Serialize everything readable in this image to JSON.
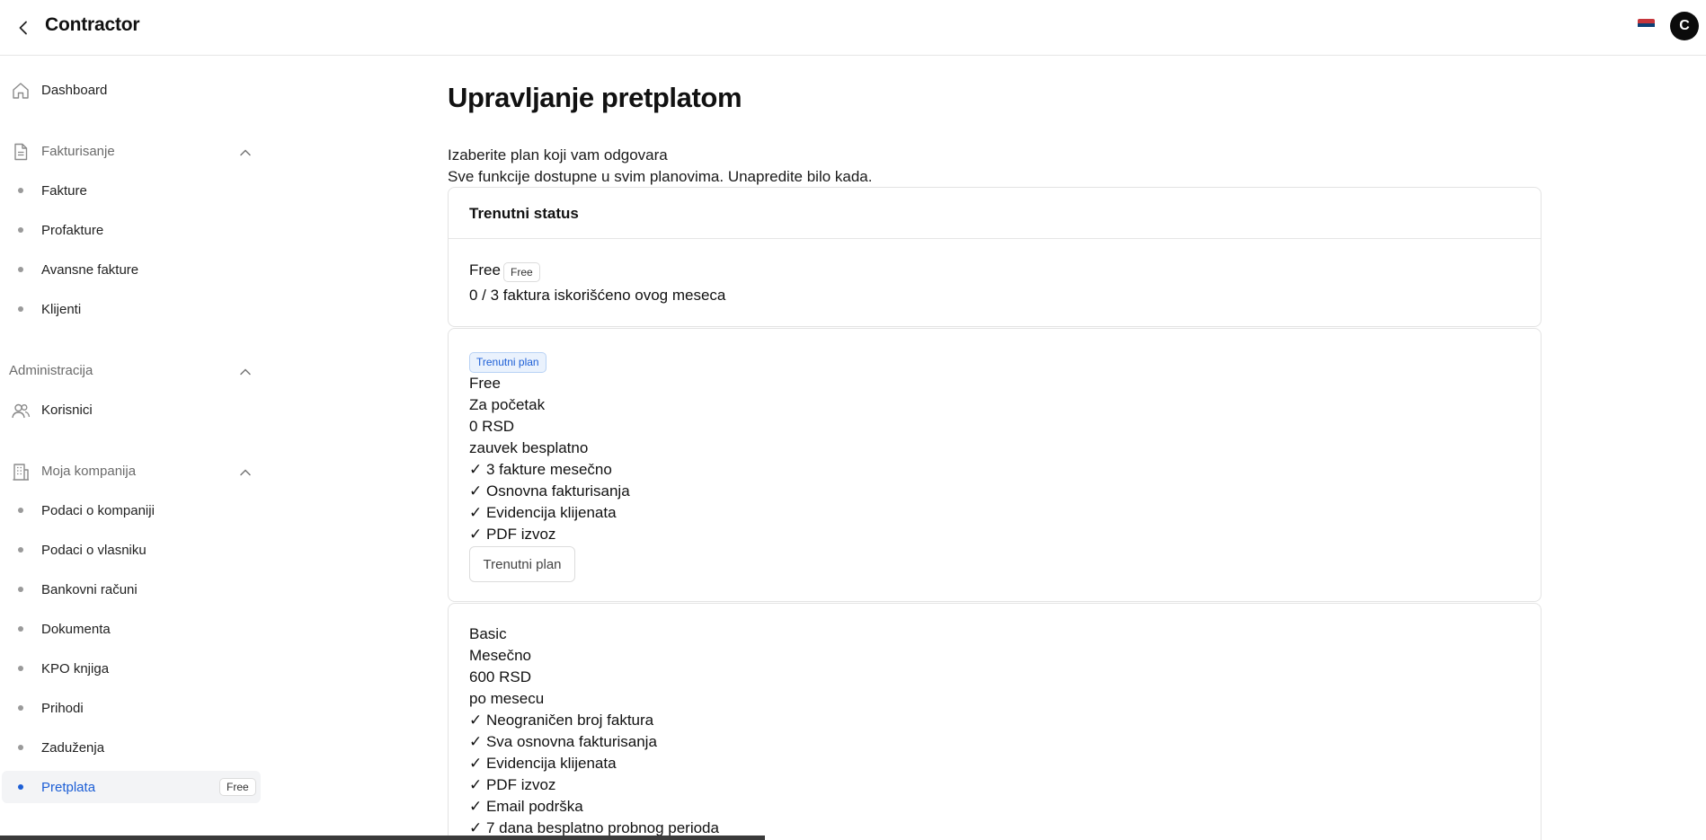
{
  "header": {
    "title": "Contractor",
    "avatar_letter": "C",
    "flag": "serbia-flag-icon"
  },
  "sidebar": {
    "dashboard": "Dashboard",
    "sections": {
      "billing": "Fakturisanje",
      "admin": "Administracija",
      "company": "Moja kompanija"
    },
    "billing_items": [
      "Fakture",
      "Profakture",
      "Avansne fakture",
      "Klijenti"
    ],
    "admin_items": [
      "Korisnici"
    ],
    "company_items": [
      "Podaci o kompaniji",
      "Podaci o vlasniku",
      "Bankovni računi",
      "Dokumenta",
      "KPO knjiga",
      "Prihodi",
      "Zaduženja",
      "Pretplata"
    ],
    "active_plan_pill": "Free"
  },
  "main": {
    "title": "Upravljanje pretplatom",
    "intro_line1": "Izaberite plan koji vam odgovara",
    "intro_line2": "Sve funkcije dostupne u svim planovima. Unapredite bilo kada.",
    "status": {
      "title": "Trenutni status",
      "plan": "Free",
      "badge": "Free",
      "usage": "0 / 3 faktura iskorišćeno ovog meseca"
    },
    "plans": [
      {
        "badge": "Trenutni plan",
        "name": "Free",
        "subtitle": "Za početak",
        "price": "0 RSD",
        "period": "zauvek besplatno",
        "features": [
          "✓ 3 fakture mesečno",
          "✓ Osnovna fakturisanja",
          "✓ Evidencija klijenata",
          "✓ PDF izvoz"
        ],
        "button": "Trenutni plan"
      },
      {
        "name": "Basic",
        "subtitle": "Mesečno",
        "price": "600 RSD",
        "period": "po mesecu",
        "features": [
          "✓ Neograničen broj faktura",
          "✓ Sva osnovna fakturisanja",
          "✓ Evidencija klijenata",
          "✓ PDF izvoz",
          "✓ Email podrška",
          "✓ 7 dana besplatno probnog perioda"
        ]
      }
    ]
  },
  "colors": {
    "accent": "#1d5fd6",
    "border": "#e3e3e3",
    "muted": "#6b6b6b"
  }
}
